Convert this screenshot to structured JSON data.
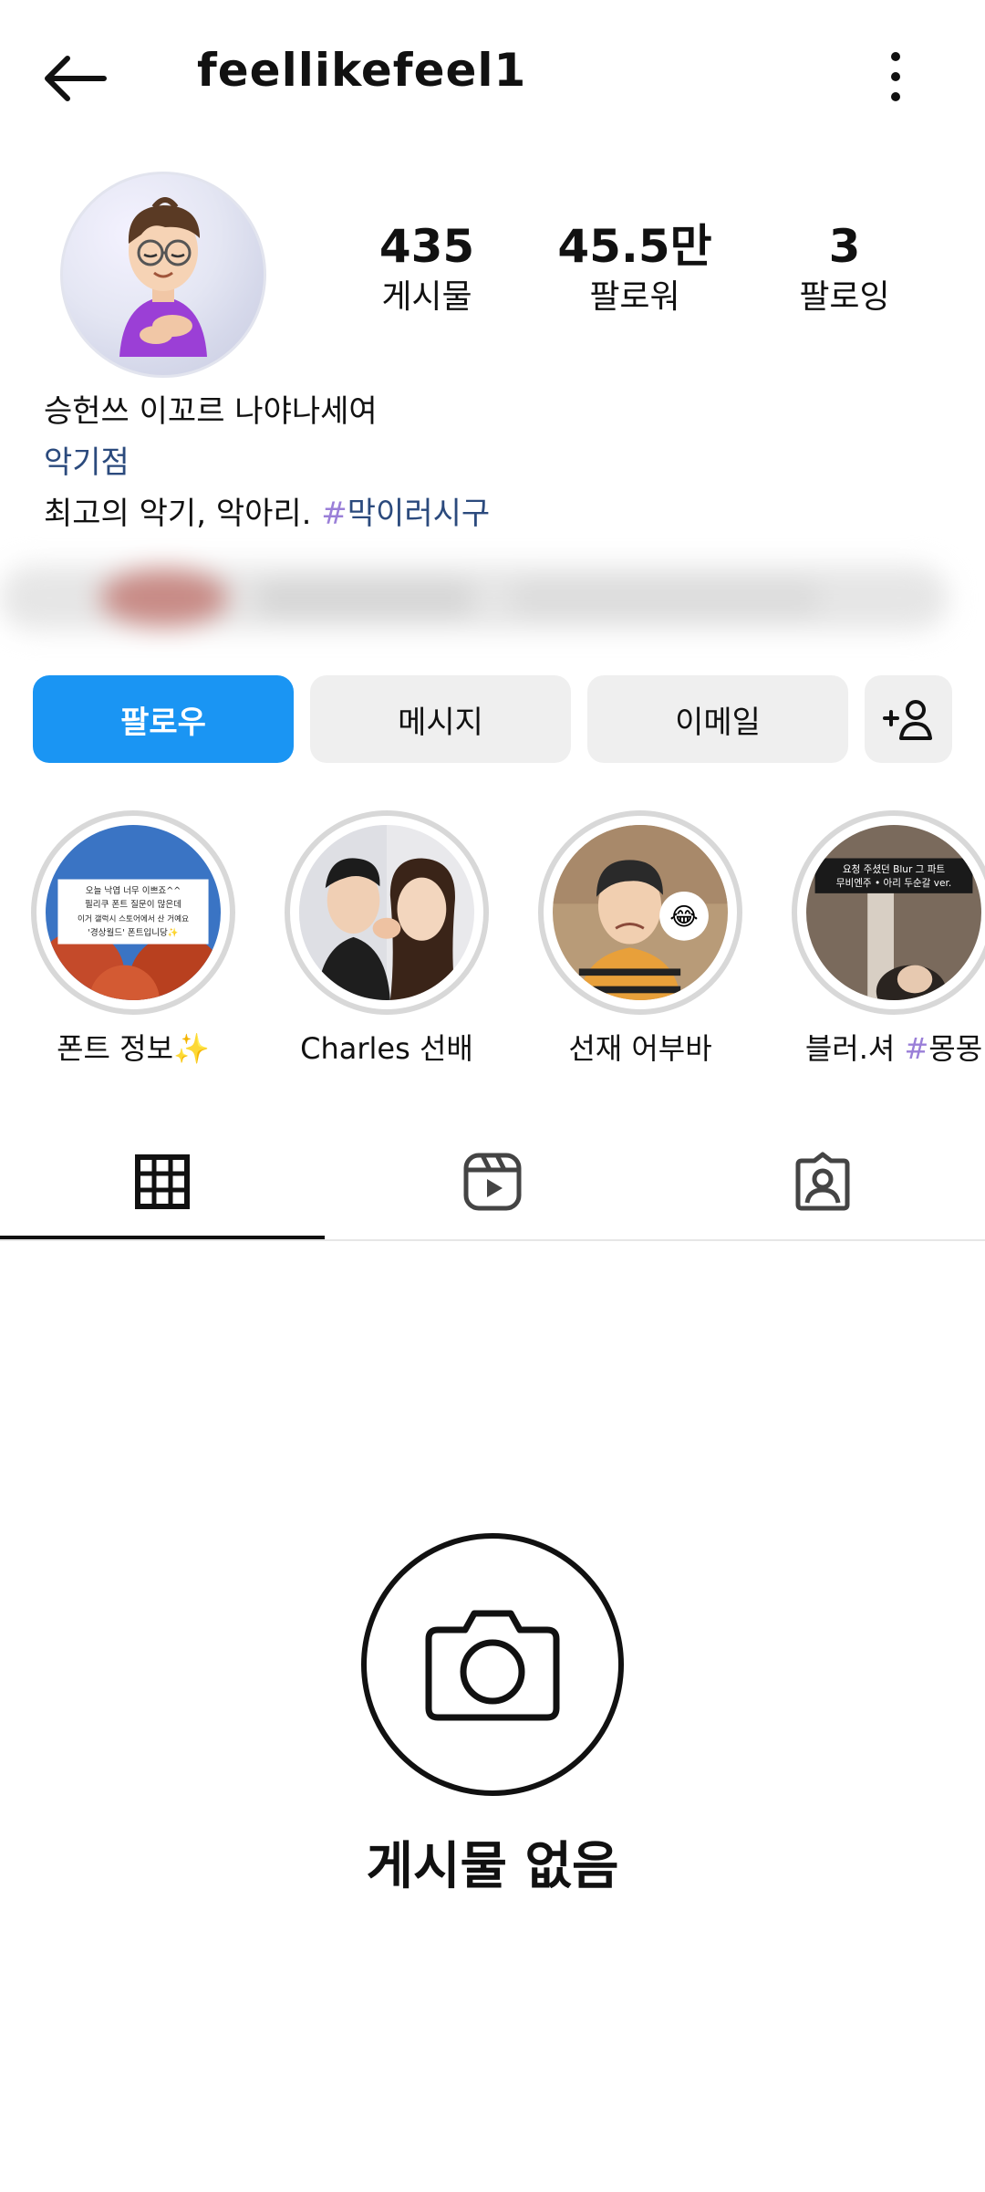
{
  "header": {
    "username": "feellikefeel1"
  },
  "stats": [
    {
      "value": "435",
      "label": "게시물"
    },
    {
      "value": "45.5만",
      "label": "팔로워"
    },
    {
      "value": "3",
      "label": "팔로잉"
    }
  ],
  "bio": {
    "name": "승헌쓰 이꼬르 나야나세여",
    "category": "악기점",
    "text": "최고의 악기, 악아리. ",
    "hashtag_mark": "#",
    "hashtag": "막이러시구"
  },
  "actions": {
    "follow": "팔로우",
    "message": "메시지",
    "email": "이메일"
  },
  "highlights": [
    {
      "label": "폰트 정보✨",
      "overlay_lines": [
        "오늘 낙엽 너무 이쁘죠^^",
        "필리쿠 폰트 질문이 많은데",
        "이거 갤럭시 스토어에서 산 거예요",
        "'경상월드' 폰트입니당✨"
      ]
    },
    {
      "label": "Charles 선배"
    },
    {
      "label": "선재 어부바",
      "emoji": "😂"
    },
    {
      "label_main": "블러.셔 ",
      "label_mark": "#",
      "label_rest": "몽몽",
      "overlay_lines": [
        "요청 주셨던 Blur 그 파트",
        "무비엔주 • 아리 두순갈 ver."
      ]
    }
  ],
  "tabs": [
    {
      "name": "grid",
      "icon": "grid-icon",
      "active": true
    },
    {
      "name": "reels",
      "icon": "reels-icon",
      "active": false
    },
    {
      "name": "tagged",
      "icon": "tagged-icon",
      "active": false
    }
  ],
  "empty_state": {
    "icon": "camera-icon",
    "text": "게시물 없음"
  },
  "colors": {
    "follow_button": "#1a95f3",
    "secondary_button": "#efefef",
    "link": "#2b4a7d"
  }
}
